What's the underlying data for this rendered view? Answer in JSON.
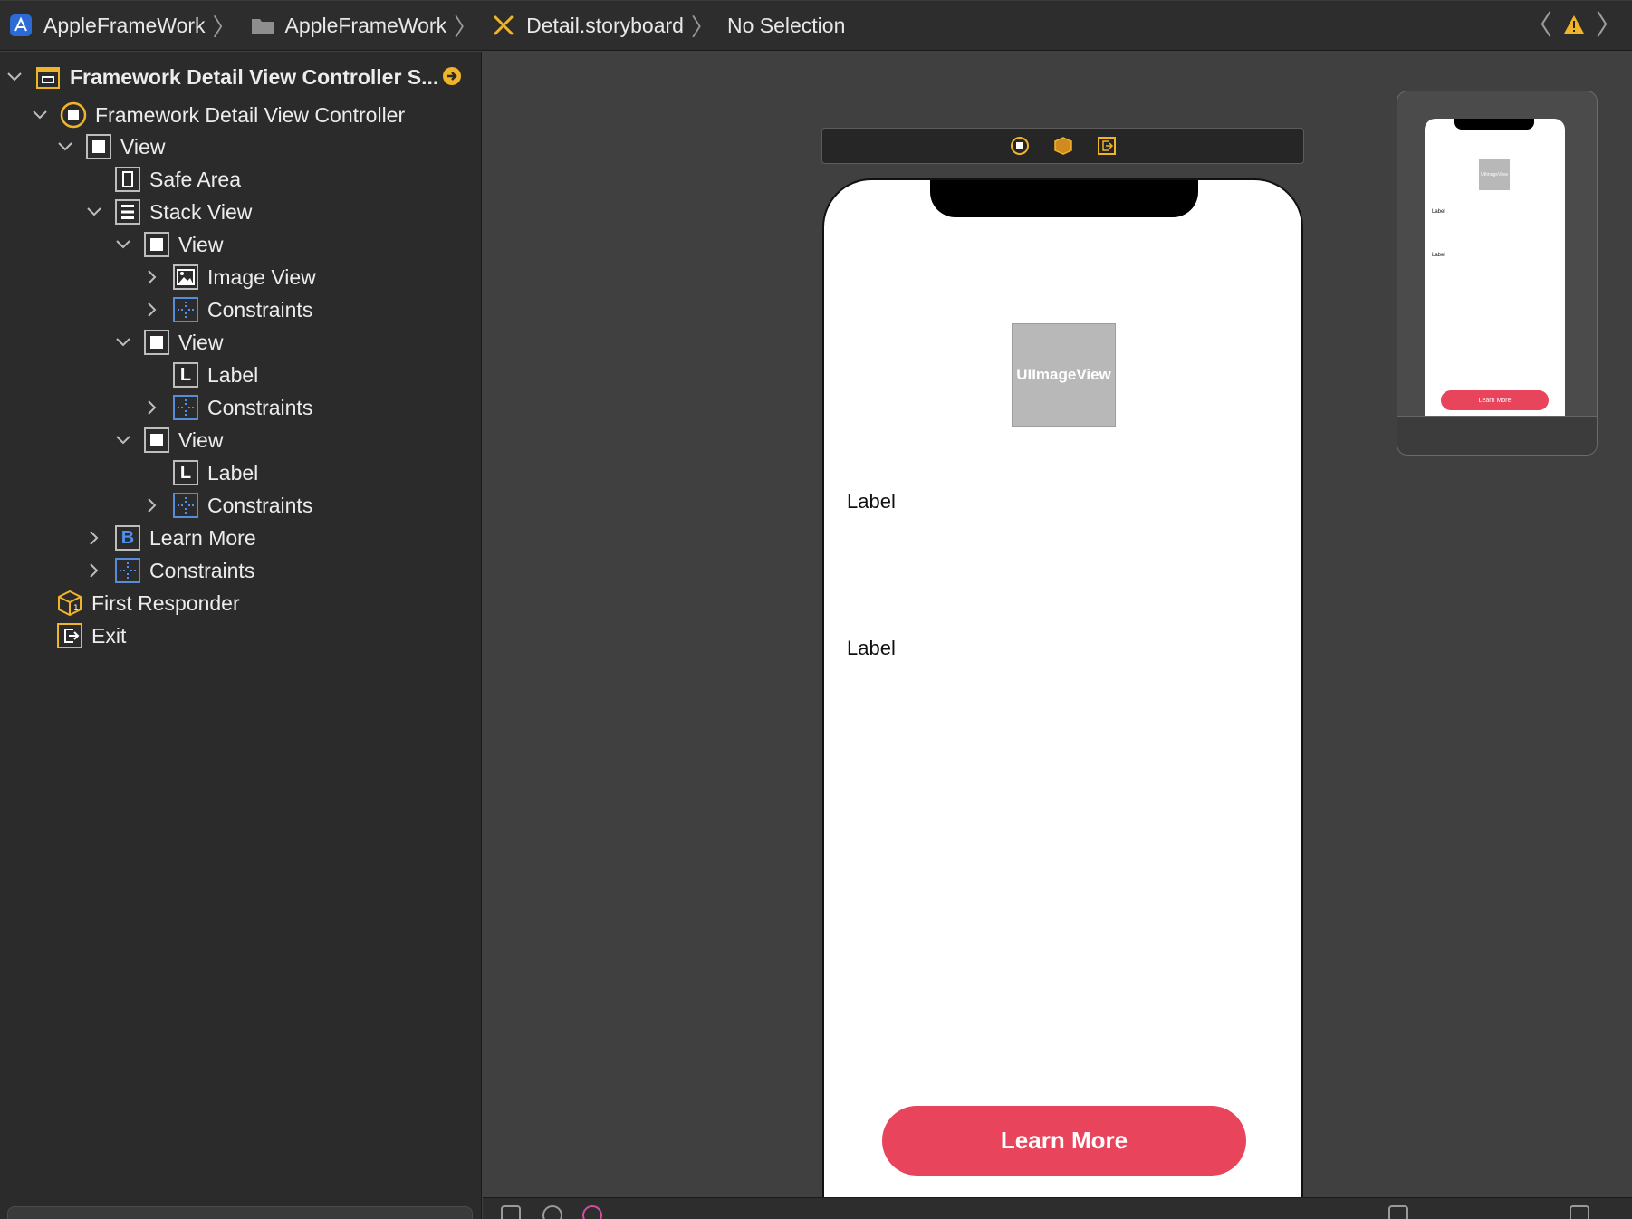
{
  "jumpbar": {
    "crumbs": [
      {
        "label": "AppleFrameWork",
        "icon": "xcode-project-icon"
      },
      {
        "label": "AppleFrameWork",
        "icon": "folder-icon"
      },
      {
        "label": "Detail.storyboard",
        "icon": "storyboard-icon"
      },
      {
        "label": "No Selection",
        "icon": ""
      }
    ],
    "back_glyph": "〈",
    "forward_glyph": "〉",
    "warning_glyph": "⚠"
  },
  "outline": {
    "scene": "Framework Detail View Controller S...",
    "controller": "Framework Detail View Controller",
    "view": "View",
    "safe_area": "Safe Area",
    "stack_view": "Stack View",
    "sub_view_1": "View",
    "image_view": "Image View",
    "constraints_1": "Constraints",
    "sub_view_2": "View",
    "label_1": "Label",
    "constraints_2": "Constraints",
    "sub_view_3": "View",
    "label_2": "Label",
    "constraints_3": "Constraints",
    "learn_more": "Learn More",
    "constraints_4": "Constraints",
    "first_responder": "First Responder",
    "exit": "Exit",
    "label_icon_letter": "L",
    "button_icon_letter": "B"
  },
  "canvas": {
    "image_view_text": "UIImageView",
    "label_top": "Label",
    "label_bottom": "Label",
    "button_label": "Learn More"
  },
  "minimap": {
    "image_text": "UIImageView",
    "label_top": "Label",
    "label_bottom": "Label",
    "button_label": "Learn More"
  },
  "colors": {
    "accent_button": "#e8445b",
    "scene_icon_yellow": "#f0b429",
    "constraint_blue": "#4f8ff0"
  }
}
